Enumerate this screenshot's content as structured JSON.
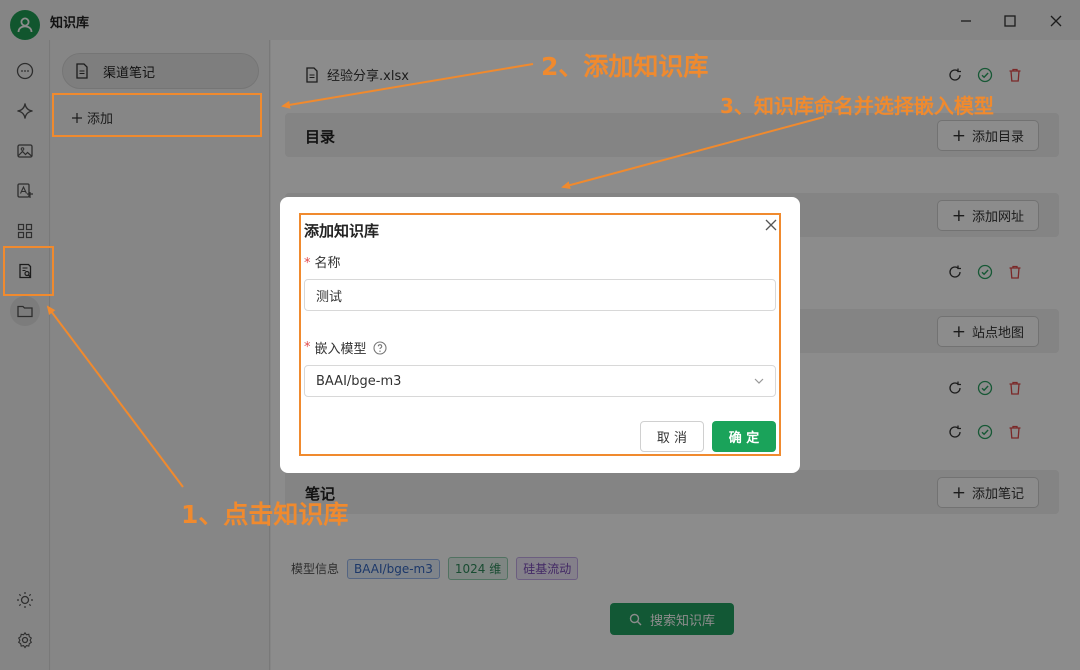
{
  "window": {
    "title": "知识库"
  },
  "colors": {
    "accent": "#1aa35a",
    "annotation": "#f08a2e",
    "danger": "#e04a4a"
  },
  "rail": {
    "icons": [
      "chat-icon",
      "sparkle-icon",
      "image-icon",
      "translate-icon",
      "apps-icon",
      "knowledge-icon",
      "folder-icon",
      "theme-icon",
      "settings-icon"
    ],
    "active": "knowledge-icon"
  },
  "kb_panel": {
    "items": [
      {
        "label": "渠道笔记"
      }
    ],
    "add_label": "添加"
  },
  "main": {
    "file_name": "经验分享.xlsx",
    "sections": {
      "directory": {
        "title": "目录",
        "button": "添加目录"
      },
      "url": {
        "button": "添加网址"
      },
      "sitemap": {
        "button": "站点地图"
      },
      "notes": {
        "title": "笔记",
        "button": "添加笔记"
      }
    },
    "model_info": {
      "label": "模型信息",
      "model": "BAAI/bge-m3",
      "dims": "1024 维",
      "provider": "硅基流动"
    },
    "search_button": "搜索知识库"
  },
  "dialog": {
    "title": "添加知识库",
    "name_label": "名称",
    "name_value": "测试",
    "model_label": "嵌入模型",
    "model_value": "BAAI/bge-m3",
    "cancel": "取 消",
    "ok": "确 定"
  },
  "annotations": {
    "step1": "1、点击知识库",
    "step2": "2、添加知识库",
    "step3": "3、知识库命名并选择嵌入模型"
  }
}
